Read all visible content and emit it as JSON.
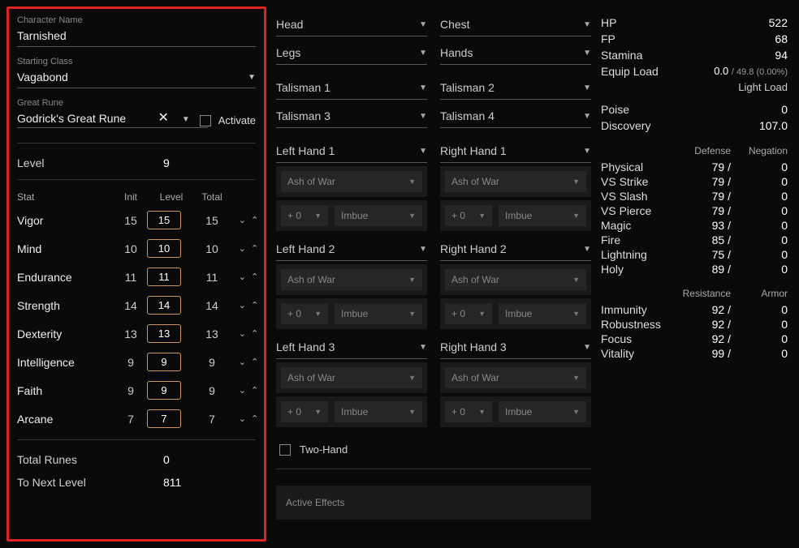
{
  "char": {
    "name_label": "Character Name",
    "name": "Tarnished",
    "class_label": "Starting Class",
    "class_value": "Vagabond",
    "rune_label": "Great Rune",
    "rune_value": "Godrick's Great Rune",
    "activate_label": "Activate",
    "level_label": "Level",
    "level_value": "9",
    "stat_header": {
      "stat": "Stat",
      "init": "Init",
      "level": "Level",
      "total": "Total"
    },
    "stats": [
      {
        "name": "Vigor",
        "init": "15",
        "level": "15",
        "total": "15"
      },
      {
        "name": "Mind",
        "init": "10",
        "level": "10",
        "total": "10"
      },
      {
        "name": "Endurance",
        "init": "11",
        "level": "11",
        "total": "11"
      },
      {
        "name": "Strength",
        "init": "14",
        "level": "14",
        "total": "14"
      },
      {
        "name": "Dexterity",
        "init": "13",
        "level": "13",
        "total": "13"
      },
      {
        "name": "Intelligence",
        "init": "9",
        "level": "9",
        "total": "9"
      },
      {
        "name": "Faith",
        "init": "9",
        "level": "9",
        "total": "9"
      },
      {
        "name": "Arcane",
        "init": "7",
        "level": "7",
        "total": "7"
      }
    ],
    "total_runes_label": "Total Runes",
    "total_runes": "0",
    "to_next_label": "To Next Level",
    "to_next": "811"
  },
  "equip": {
    "armor": [
      "Head",
      "Chest",
      "Legs",
      "Hands"
    ],
    "talismans": [
      "Talisman 1",
      "Talisman 2",
      "Talisman 3",
      "Talisman 4"
    ],
    "hands": [
      {
        "left": "Left Hand 1",
        "right": "Right Hand 1"
      },
      {
        "left": "Left Hand 2",
        "right": "Right Hand 2"
      },
      {
        "left": "Left Hand 3",
        "right": "Right Hand 3"
      }
    ],
    "ash_label": "Ash of War",
    "upgrade_label": "+ 0",
    "imbue_label": "Imbue",
    "two_hand_label": "Two-Hand",
    "effects_label": "Active Effects"
  },
  "summary": {
    "basic": [
      {
        "label": "HP",
        "value": "522"
      },
      {
        "label": "FP",
        "value": "68"
      },
      {
        "label": "Stamina",
        "value": "94"
      }
    ],
    "equip_load_label": "Equip Load",
    "equip_load_value": "0.0",
    "equip_load_max": "/ 49.8 (0.00%)",
    "load_type": "Light Load",
    "misc": [
      {
        "label": "Poise",
        "value": "0"
      },
      {
        "label": "Discovery",
        "value": "107.0"
      }
    ],
    "def_header": {
      "def": "Defense",
      "neg": "Negation"
    },
    "defenses": [
      {
        "label": "Physical",
        "def": "79 /",
        "neg": "0"
      },
      {
        "label": "VS Strike",
        "def": "79 /",
        "neg": "0"
      },
      {
        "label": "VS Slash",
        "def": "79 /",
        "neg": "0"
      },
      {
        "label": "VS Pierce",
        "def": "79 /",
        "neg": "0"
      },
      {
        "label": "Magic",
        "def": "93 /",
        "neg": "0"
      },
      {
        "label": "Fire",
        "def": "85 /",
        "neg": "0"
      },
      {
        "label": "Lightning",
        "def": "75 /",
        "neg": "0"
      },
      {
        "label": "Holy",
        "def": "89 /",
        "neg": "0"
      }
    ],
    "res_header": {
      "res": "Resistance",
      "arm": "Armor"
    },
    "resistances": [
      {
        "label": "Immunity",
        "res": "92 /",
        "arm": "0"
      },
      {
        "label": "Robustness",
        "res": "92 /",
        "arm": "0"
      },
      {
        "label": "Focus",
        "res": "92 /",
        "arm": "0"
      },
      {
        "label": "Vitality",
        "res": "99 /",
        "arm": "0"
      }
    ]
  }
}
